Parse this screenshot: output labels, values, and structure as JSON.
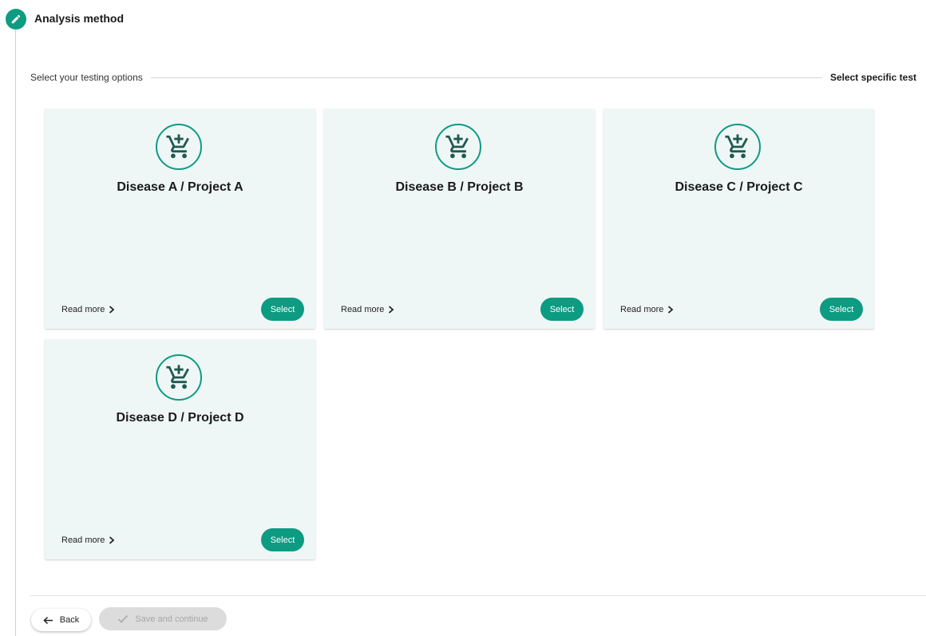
{
  "step": {
    "title": "Analysis method",
    "badge_icon": "pencil-icon"
  },
  "section": {
    "left_label": "Select your testing options",
    "right_label": "Select specific test"
  },
  "cards": [
    {
      "title": "Disease A / Project A",
      "read_more": "Read more",
      "select_label": "Select",
      "icon": "cart-add-icon"
    },
    {
      "title": "Disease B / Project B",
      "read_more": "Read more",
      "select_label": "Select",
      "icon": "cart-add-icon"
    },
    {
      "title": "Disease C / Project C",
      "read_more": "Read more",
      "select_label": "Select",
      "icon": "cart-add-icon"
    },
    {
      "title": "Disease D / Project D",
      "read_more": "Read more",
      "select_label": "Select",
      "icon": "cart-add-icon"
    }
  ],
  "footer": {
    "back_label": "Back",
    "save_label": "Save and continue"
  },
  "colors": {
    "accent": "#0d9b82",
    "card_bg": "#eff7f6",
    "disabled_bg": "#dcdcdc",
    "disabled_text": "#a6a6a6"
  }
}
